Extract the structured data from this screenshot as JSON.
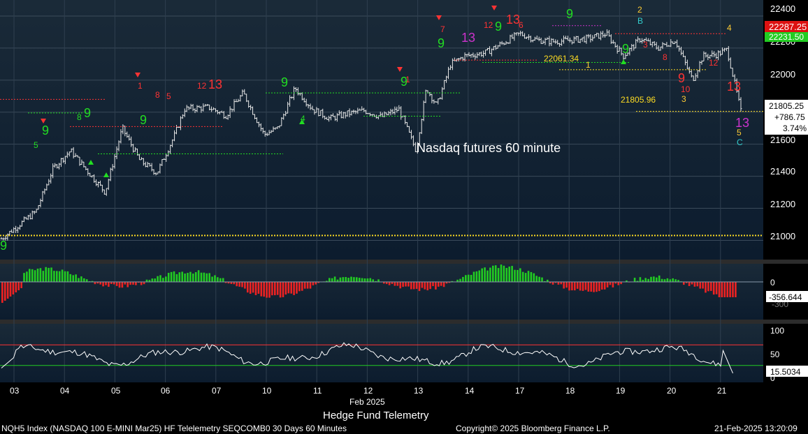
{
  "chart_data": [
    {
      "type": "candlestick",
      "panel": "price",
      "annotation": "Nasdaq futures 60 minute",
      "ylim": [
        20880,
        22500
      ],
      "yticks": [
        "22400",
        "22200",
        "22000",
        "21800",
        "21600",
        "21400",
        "21200",
        "21000"
      ],
      "last_price": "22287.25",
      "prev_level": "22231.50",
      "last_close": "21805.25",
      "change": "+786.75",
      "change_pct": "3.74%",
      "level_labels": [
        "22061.34",
        "21805.96"
      ],
      "series": [
        {
          "name": "",
          "x": [
            0,
            1,
            1.5,
            2,
            3,
            3.5,
            4,
            4.5,
            5,
            5.3,
            6,
            6.5,
            7,
            7.6,
            8,
            8.5,
            9,
            9.5,
            10,
            10.5,
            11,
            11.5,
            12,
            12.3,
            12.6,
            13,
            13.4,
            14,
            14.5,
            15,
            15.5,
            16,
            17,
            17.5,
            18,
            18.5,
            19,
            19.5,
            20,
            20.3,
            20.7,
            21,
            21.2,
            21.4
          ],
          "close": [
            21010,
            21180,
            21450,
            21560,
            21300,
            21700,
            21500,
            21420,
            21650,
            21820,
            21830,
            21780,
            21920,
            21660,
            21700,
            21950,
            21820,
            21760,
            21790,
            21810,
            21770,
            21820,
            21560,
            21950,
            21840,
            22100,
            22150,
            22170,
            22230,
            22290,
            22250,
            22240,
            22260,
            22290,
            22150,
            22260,
            22200,
            22250,
            22000,
            22150,
            22160,
            22190,
            22000,
            21805
          ]
        }
      ]
    },
    {
      "type": "bar",
      "panel": "oscillator",
      "yticks": [
        "0"
      ],
      "last_value": "-356.644",
      "partial_tick": "-300"
    },
    {
      "type": "line",
      "panel": "rsi",
      "yticks": [
        "100",
        "50",
        "0"
      ],
      "last_value": "15.5034",
      "reference_lines": [
        70,
        30
      ]
    }
  ],
  "x_axis": {
    "labels": [
      "03",
      "04",
      "05",
      "06",
      "07",
      "10",
      "11",
      "12",
      "13",
      "14",
      "17",
      "18",
      "19",
      "20",
      "21"
    ],
    "month_label": "Feb 2025",
    "study_title": "Hedge Fund Telemetry"
  },
  "footer": {
    "left": "NQH5 Index (NASDAQ 100 E-MINI Mar25) HF Telelemetry SEQCOMB0 30 Days 60 Minutes",
    "center": "Copyright© 2025 Bloomberg Finance L.P.",
    "right": "21-Feb-2025 13:20:09"
  },
  "td_labels": [
    {
      "text": "9",
      "color": "#22dd22"
    },
    {
      "text": "5",
      "color": "#22dd22"
    },
    {
      "text": "9",
      "color": "#22dd22"
    },
    {
      "text": "8",
      "color": "#22dd22"
    },
    {
      "text": "9",
      "color": "#22dd22"
    },
    {
      "text": "1",
      "color": "#ff3333"
    },
    {
      "text": "9",
      "color": "#22dd22"
    },
    {
      "text": "8",
      "color": "#ff3333"
    },
    {
      "text": "5",
      "color": "#ff3333"
    },
    {
      "text": "12",
      "color": "#ff3333"
    },
    {
      "text": "13",
      "color": "#ff3333"
    },
    {
      "text": "9",
      "color": "#22dd22"
    },
    {
      "text": "4",
      "color": "#22dd22"
    },
    {
      "text": "9",
      "color": "#22dd22"
    },
    {
      "text": "1",
      "color": "#ff3333"
    },
    {
      "text": "7",
      "color": "#ff3333"
    },
    {
      "text": "9",
      "color": "#22dd22"
    },
    {
      "text": "13",
      "color": "#cc33cc"
    },
    {
      "text": "12",
      "color": "#ff3333"
    },
    {
      "text": "9",
      "color": "#22dd22"
    },
    {
      "text": "13",
      "color": "#ff3333"
    },
    {
      "text": "6",
      "color": "#ff3333"
    },
    {
      "text": "9",
      "color": "#22dd22"
    },
    {
      "text": "2",
      "color": "#ffcc33"
    },
    {
      "text": "B",
      "color": "#33cccc"
    },
    {
      "text": "3",
      "color": "#ff3333"
    },
    {
      "text": "8",
      "color": "#ff3333"
    },
    {
      "text": "9",
      "color": "#22dd22"
    },
    {
      "text": "1",
      "color": "#ffcc33"
    },
    {
      "text": "9",
      "color": "#ff3333"
    },
    {
      "text": "10",
      "color": "#ff3333"
    },
    {
      "text": "12",
      "color": "#ff3333"
    },
    {
      "text": "4",
      "color": "#ffcc33"
    },
    {
      "text": "13",
      "color": "#ff3333"
    },
    {
      "text": "3",
      "color": "#ffcc33"
    },
    {
      "text": "13",
      "color": "#cc33cc"
    },
    {
      "text": "5",
      "color": "#ffcc33"
    },
    {
      "text": "C",
      "color": "#33cccc"
    }
  ],
  "colors": {
    "up": "#22cc22",
    "down": "#ee2222",
    "td_green": "#22dd22",
    "td_red": "#ff3333",
    "td_magenta": "#cc33cc",
    "level_yellow": "#ffdd22",
    "rsi_top": "#ff3333",
    "rsi_bottom": "#22cc22"
  }
}
